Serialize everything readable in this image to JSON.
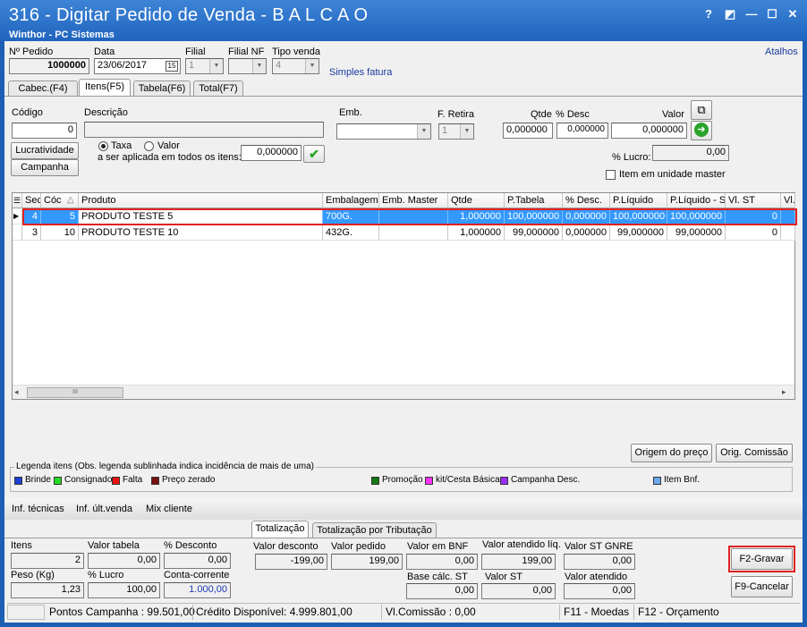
{
  "window": {
    "title": "316 - Digitar Pedido de Venda - B A L C A O",
    "subtitle": "Winthor - PC Sistemas",
    "help": "?",
    "restore": "◩",
    "minimize": "—",
    "maximize": "☐",
    "close": "✕"
  },
  "header": {
    "atalhos": "Atalhos",
    "nro_pedido_label": "Nº Pedido",
    "nro_pedido": "1000000",
    "data_label": "Data",
    "data": "23/06/2017",
    "cal_icon": "15",
    "filial_label": "Filial",
    "filial": "1",
    "filial_nf_label": "Filial NF",
    "filial_nf": "",
    "tipo_venda_label": "Tipo venda",
    "tipo_venda": "4",
    "tipo_venda_desc": "Simples fatura"
  },
  "tabs": [
    {
      "label": "Cabec.(F4)"
    },
    {
      "label": "Itens(F5)"
    },
    {
      "label": "Tabela(F6)"
    },
    {
      "label": "Total(F7)"
    }
  ],
  "item": {
    "codigo_label": "Código",
    "codigo": "0",
    "descricao_label": "Descrição",
    "descricao": "",
    "emb_label": "Emb.",
    "emb": "",
    "f_retira_label": "F. Retira",
    "f_retira": "1",
    "qtde_label": "Qtde",
    "qtde": "0,000000",
    "desc_label": "% Desc",
    "desc": "0,000000",
    "valor_label": "Valor",
    "valor": "0,000000",
    "lucratividade": "Lucratividade",
    "campanha": "Campanha",
    "taxa": "Taxa",
    "valor_radio": "Valor",
    "aplicada_label": "a ser aplicada em todos os itens:",
    "aplicada": "0,000000",
    "lucro_label": "% Lucro:",
    "lucro": "0,00",
    "item_master": "Item em unidade master"
  },
  "grid": {
    "headers": [
      "Sec",
      "Cóc",
      "Produto",
      "Embalagem",
      "Emb. Master",
      "Qtde",
      "P.Tabela",
      "% Desc.",
      "P.Líquido",
      "P.Líquido - S",
      "Vl. ST",
      "Vl."
    ],
    "rows": [
      [
        "4",
        "5",
        "PRODUTO TESTE 5",
        "700G.",
        "",
        "1,000000",
        "100,000000",
        "0,000000",
        "100,000000",
        "100,000000",
        "0"
      ],
      [
        "3",
        "10",
        "PRODUTO TESTE 10",
        "432G.",
        "",
        "1,000000",
        "99,000000",
        "0,000000",
        "99,000000",
        "99,000000",
        "0"
      ]
    ],
    "scroll_thumb": "III",
    "scroll_left": "◂",
    "scroll_right": "▸"
  },
  "buttons": {
    "origem_preco": "Origem do preço",
    "orig_comissao": "Orig. Comissão",
    "gravar": "F2-Gravar",
    "cancelar": "F9-Cancelar"
  },
  "legend": {
    "title": "Legenda itens (Obs. legenda sublinhada indica incidência de mais de uma)",
    "items": [
      {
        "label": "Brinde",
        "color": "#1f3fd6"
      },
      {
        "label": "Consignado",
        "color": "#22dd22"
      },
      {
        "label": "Falta",
        "color": "#ee1111"
      },
      {
        "label": "Preço zerado",
        "color": "#7a1010"
      },
      {
        "label": "Promoção",
        "color": "#137a13"
      },
      {
        "label": "kit/Cesta Básica",
        "color": "#ff33ff"
      },
      {
        "label": "Campanha Desc.",
        "color": "#9b2fff"
      },
      {
        "label": "Item Bnf.",
        "color": "#6aaaf0"
      }
    ]
  },
  "links": {
    "inf_tecnicas": "Inf. técnicas",
    "inf_ult_venda": "Inf. últ.venda",
    "mix_cliente": "Mix cliente"
  },
  "bottom_tabs": [
    {
      "label": "Totalização"
    },
    {
      "label": "Totalização por Tributação"
    }
  ],
  "totals": {
    "itens_label": "Itens",
    "itens": "2",
    "valor_tabela_label": "Valor tabela",
    "valor_tabela": "0,00",
    "pct_desconto_label": "% Desconto",
    "pct_desconto": "0,00",
    "peso_label": "Peso (Kg)",
    "peso": "1,23",
    "pct_lucro_label": "% Lucro",
    "pct_lucro": "100,00",
    "conta_corrente_label": "Conta-corrente",
    "conta_corrente": "1.000,00",
    "valor_desconto_label": "Valor desconto",
    "valor_desconto": "-199,00",
    "valor_pedido_label": "Valor pedido",
    "valor_pedido": "199,00",
    "valor_bnf_label": "Valor em BNF",
    "valor_bnf": "0,00",
    "valor_atendido_liq_label": "Valor atendido líq.",
    "valor_atendido_liq": "199,00",
    "valor_st_gnre_label": "Valor ST GNRE",
    "valor_st_gnre": "0,00",
    "base_calc_st_label": "Base cálc. ST",
    "base_calc_st": "0,00",
    "valor_st_label": "Valor ST",
    "valor_st": "0,00",
    "valor_atendido_label": "Valor atendido",
    "valor_atendido": "0,00"
  },
  "status": {
    "pontos": "Pontos Campanha : 99.501,00",
    "credito": "Crédito Disponível: 4.999.801,00",
    "comissao": "Vl.Comissão : 0,00",
    "f11": "F11 - Moedas",
    "f12": "F12 - Orçamento"
  }
}
